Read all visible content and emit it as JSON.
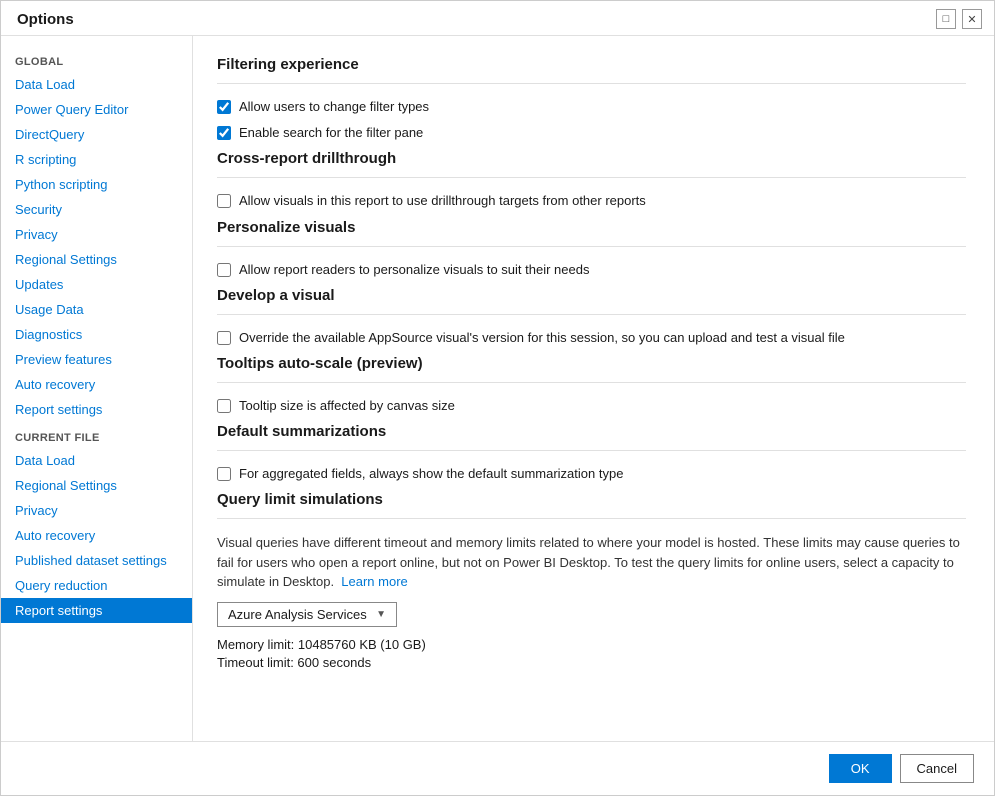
{
  "dialog": {
    "title": "Options",
    "controls": {
      "minimize": "□",
      "close": "✕"
    }
  },
  "sidebar": {
    "global_label": "GLOBAL",
    "global_items": [
      {
        "id": "data-load",
        "label": "Data Load"
      },
      {
        "id": "power-query-editor",
        "label": "Power Query Editor"
      },
      {
        "id": "direct-query",
        "label": "DirectQuery"
      },
      {
        "id": "r-scripting",
        "label": "R scripting"
      },
      {
        "id": "python-scripting",
        "label": "Python scripting"
      },
      {
        "id": "security",
        "label": "Security"
      },
      {
        "id": "privacy",
        "label": "Privacy"
      },
      {
        "id": "regional-settings",
        "label": "Regional Settings"
      },
      {
        "id": "updates",
        "label": "Updates"
      },
      {
        "id": "usage-data",
        "label": "Usage Data"
      },
      {
        "id": "diagnostics",
        "label": "Diagnostics"
      },
      {
        "id": "preview-features",
        "label": "Preview features"
      },
      {
        "id": "auto-recovery",
        "label": "Auto recovery"
      },
      {
        "id": "report-settings",
        "label": "Report settings"
      }
    ],
    "current_file_label": "CURRENT FILE",
    "current_file_items": [
      {
        "id": "cf-data-load",
        "label": "Data Load"
      },
      {
        "id": "cf-regional-settings",
        "label": "Regional Settings"
      },
      {
        "id": "cf-privacy",
        "label": "Privacy"
      },
      {
        "id": "cf-auto-recovery",
        "label": "Auto recovery"
      },
      {
        "id": "cf-published-dataset-settings",
        "label": "Published dataset settings"
      },
      {
        "id": "cf-query-reduction",
        "label": "Query reduction"
      },
      {
        "id": "cf-report-settings",
        "label": "Report settings",
        "active": true
      }
    ]
  },
  "content": {
    "sections": [
      {
        "id": "filtering-experience",
        "title": "Filtering experience",
        "checkboxes": [
          {
            "id": "allow-filter-types",
            "label": "Allow users to change filter types",
            "checked": true
          },
          {
            "id": "enable-search-filter",
            "label": "Enable search for the filter pane",
            "checked": true
          }
        ]
      },
      {
        "id": "cross-report-drillthrough",
        "title": "Cross-report drillthrough",
        "checkboxes": [
          {
            "id": "allow-visuals-drillthrough",
            "label": "Allow visuals in this report to use drillthrough targets from other reports",
            "checked": false
          }
        ]
      },
      {
        "id": "personalize-visuals",
        "title": "Personalize visuals",
        "checkboxes": [
          {
            "id": "allow-personalize",
            "label": "Allow report readers to personalize visuals to suit their needs",
            "checked": false
          }
        ]
      },
      {
        "id": "develop-visual",
        "title": "Develop a visual",
        "checkboxes": [
          {
            "id": "override-appsource",
            "label": "Override the available AppSource visual's version for this session, so you can upload and test a visual file",
            "checked": false
          }
        ]
      },
      {
        "id": "tooltips-auto-scale",
        "title": "Tooltips auto-scale (preview)",
        "checkboxes": [
          {
            "id": "tooltip-canvas",
            "label": "Tooltip size is affected by canvas size",
            "checked": false
          }
        ]
      },
      {
        "id": "default-summarizations",
        "title": "Default summarizations",
        "checkboxes": [
          {
            "id": "show-default-summarization",
            "label": "For aggregated fields, always show the default summarization type",
            "checked": false
          }
        ]
      },
      {
        "id": "query-limit-simulations",
        "title": "Query limit simulations",
        "description": "Visual queries have different timeout and memory limits related to where your model is hosted. These limits may cause queries to fail for users who open a report online, but not on Power BI Desktop. To test the query limits for online users, select a capacity to simulate in Desktop.",
        "learn_more_text": "Learn more",
        "dropdown_value": "Azure Analysis Services",
        "memory_limit": "Memory limit: 10485760 KB (10 GB)",
        "timeout_limit": "Timeout limit: 600 seconds"
      }
    ]
  },
  "footer": {
    "ok_label": "OK",
    "cancel_label": "Cancel"
  }
}
